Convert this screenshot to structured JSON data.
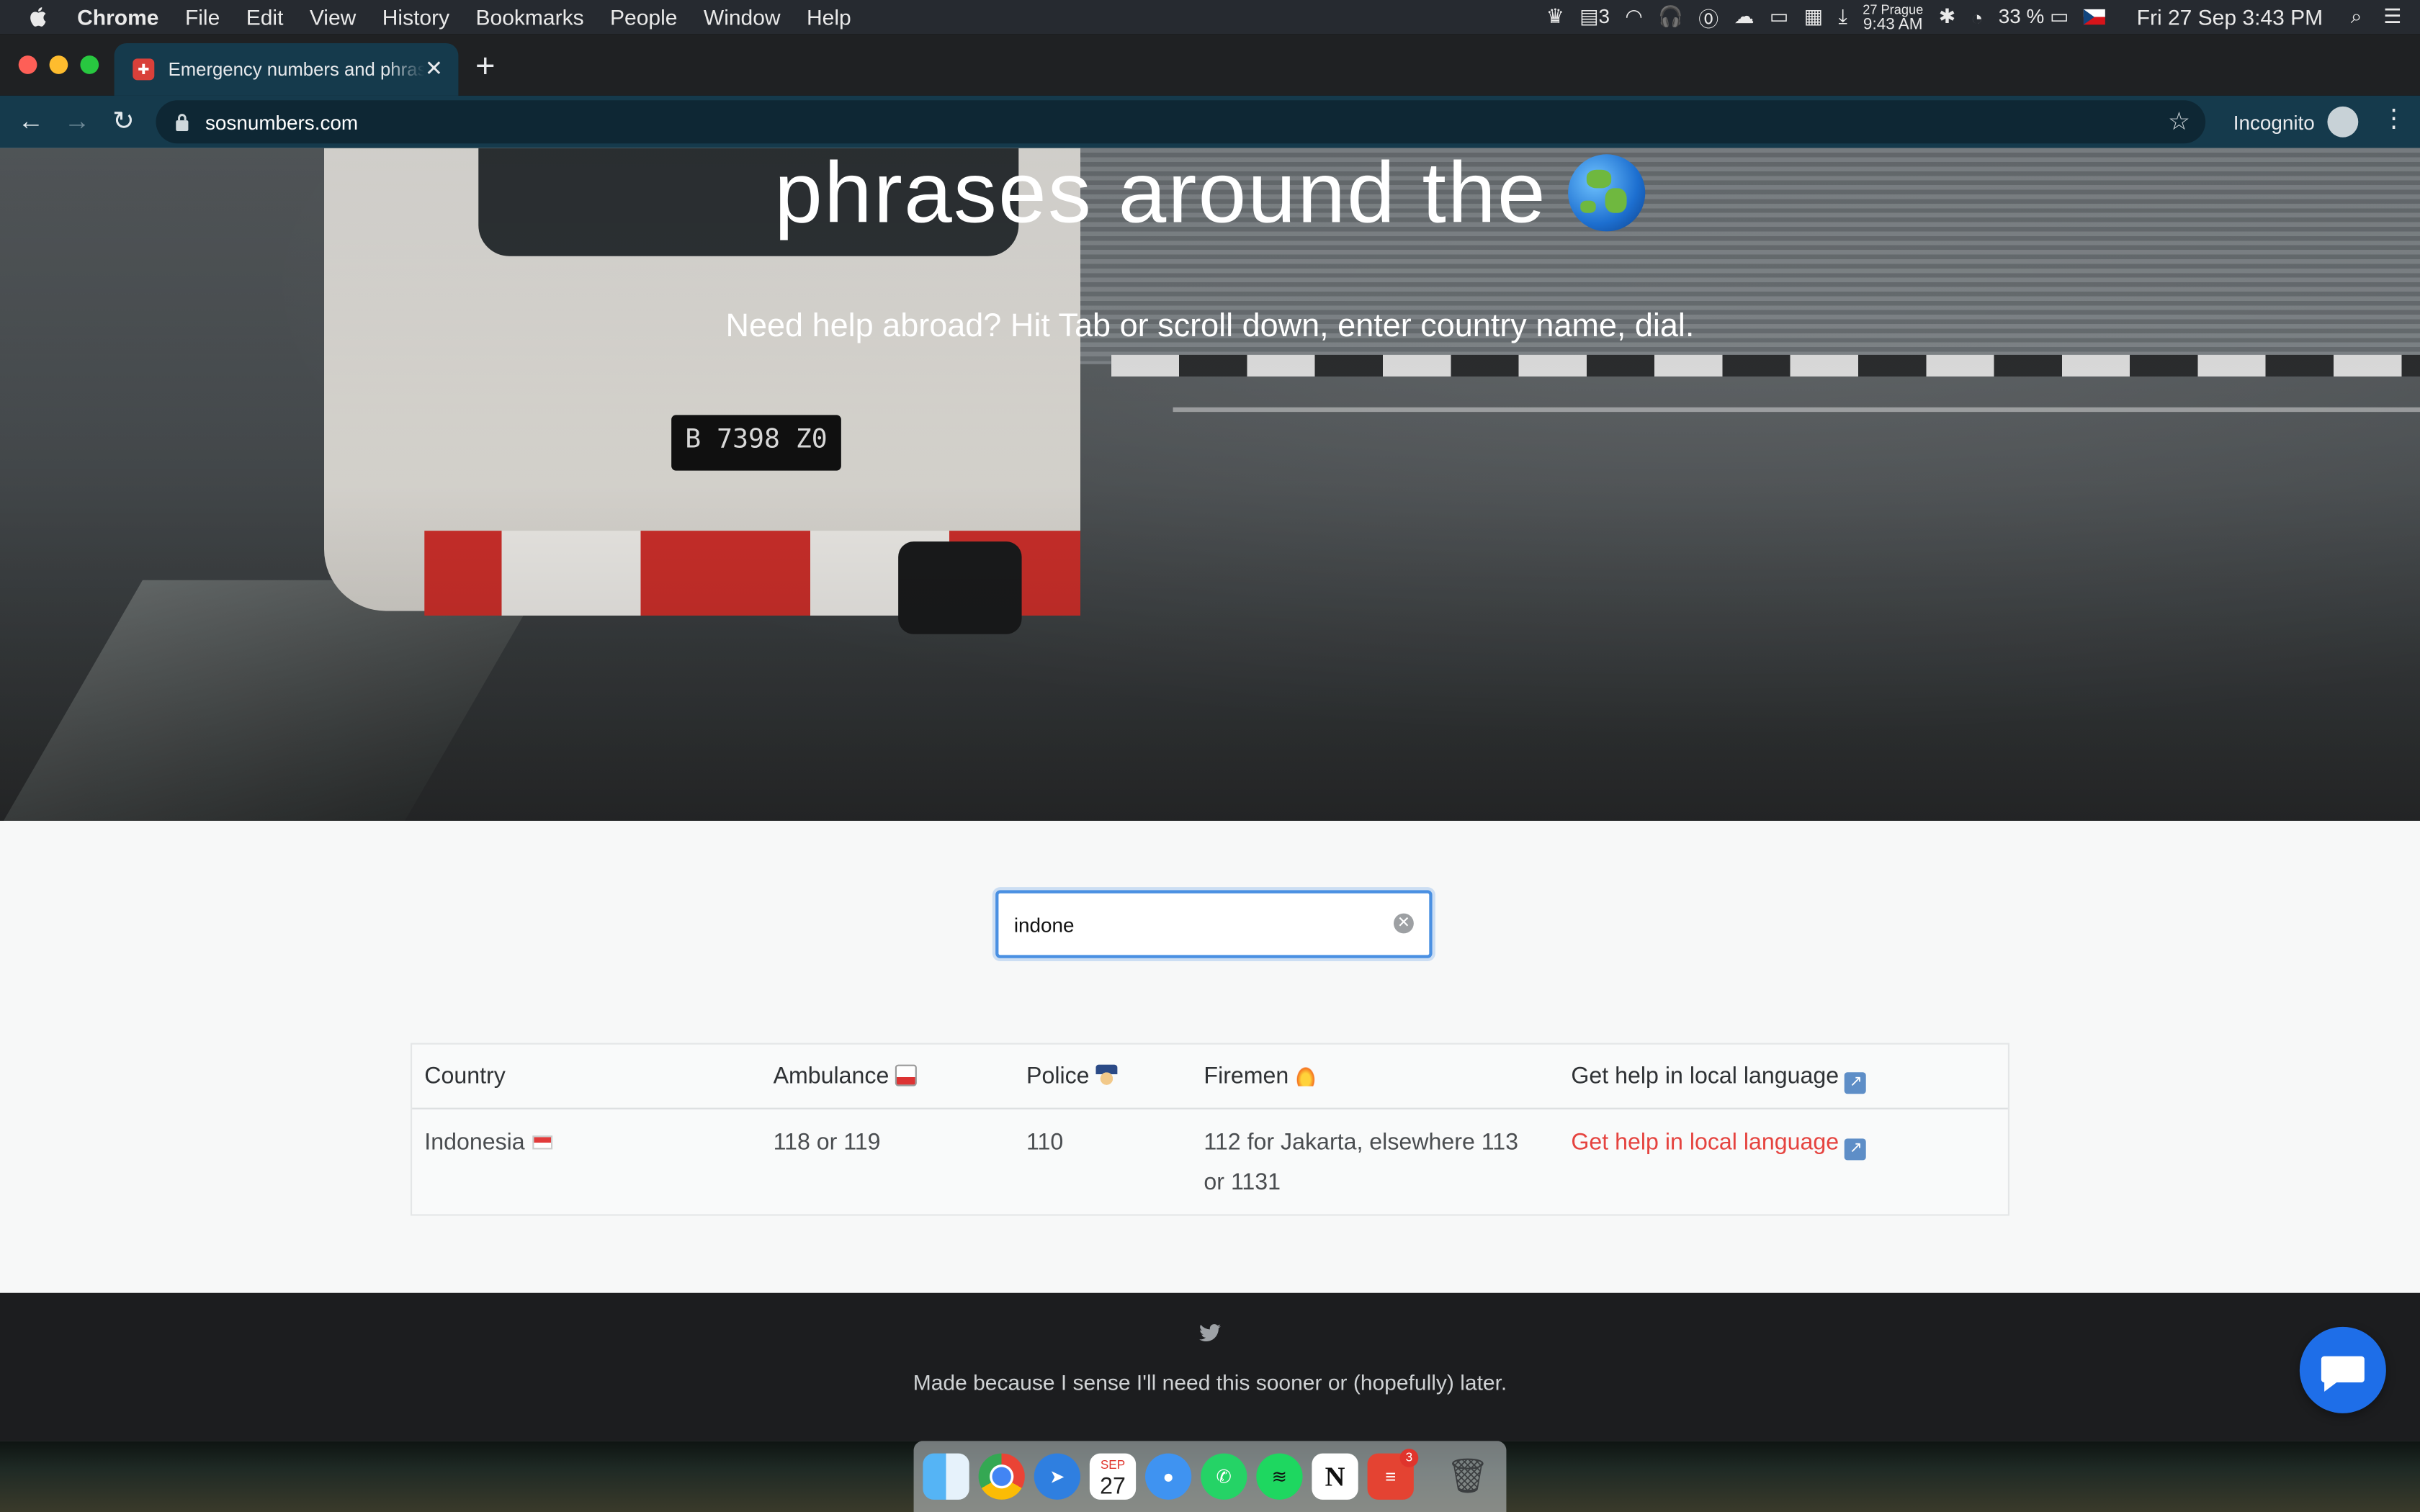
{
  "menubar": {
    "app": "Chrome",
    "items": [
      "File",
      "Edit",
      "View",
      "History",
      "Bookmarks",
      "People",
      "Window",
      "Help"
    ],
    "tray": {
      "badge_count": "3",
      "clock_city": "27 Prague",
      "clock_time": "9:43 AM",
      "battery": "33 %",
      "datetime": "Fri 27 Sep  3:43 PM"
    }
  },
  "browser": {
    "tab_title": "Emergency numbers and phrases around the world",
    "url": "sosnumbers.com",
    "incognito_label": "Incognito"
  },
  "hero": {
    "headline": "phrases around the",
    "subtitle": "Need help abroad? Hit Tab or scroll down, enter country name, dial."
  },
  "search": {
    "value": "indone"
  },
  "table": {
    "headers": {
      "country": "Country",
      "ambulance": "Ambulance",
      "police": "Police",
      "firemen": "Firemen",
      "help": "Get help in local language"
    },
    "rows": [
      {
        "country": "Indonesia",
        "ambulance": "118 or 119",
        "police": "110",
        "firemen": "112 for Jakarta, elsewhere 113 or 1131",
        "help": "Get help in local language"
      }
    ]
  },
  "footer": {
    "note": "Made because I sense I'll need this sooner or (hopefully) later."
  },
  "dock": {
    "calendar_month": "SEP",
    "calendar_day": "27",
    "todoist_badge": "3"
  },
  "colors": {
    "link": "#e5433f",
    "toolbar": "#153a4c",
    "focus_ring": "#4a90e2",
    "chat_button": "#1e6ee8"
  }
}
